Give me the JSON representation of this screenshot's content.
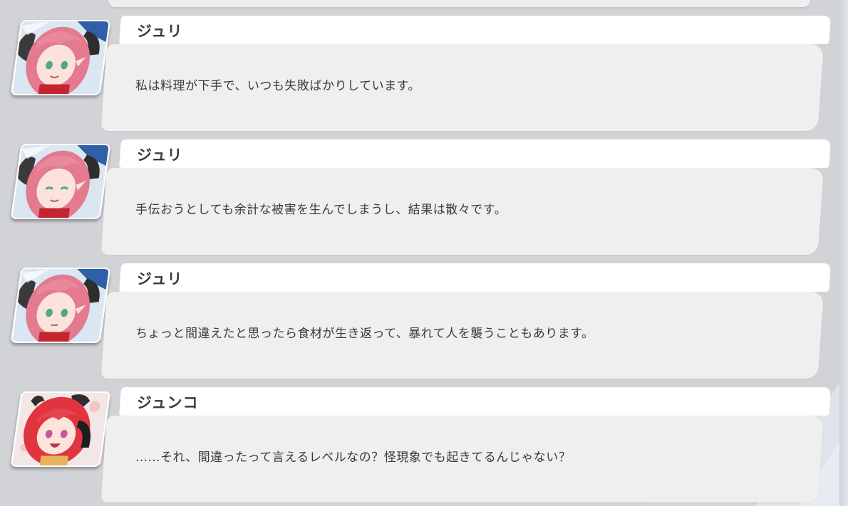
{
  "entries": [
    {
      "speaker": "ジュリ",
      "avatar": "juri-portrait",
      "text": "私は料理が下手で、いつも失敗ばかりしています。"
    },
    {
      "speaker": "ジュリ",
      "avatar": "juri-portrait",
      "text": "手伝おうとしても余計な被害を生んでしまうし、結果は散々です。"
    },
    {
      "speaker": "ジュリ",
      "avatar": "juri-portrait",
      "text": "ちょっと間違えたと思ったら食材が生き返って、暴れて人を襲うこともあります。"
    },
    {
      "speaker": "ジュンコ",
      "avatar": "junko-portrait",
      "text": "……それ、間違ったって言えるレベルなの？怪現象でも起きてるんじゃない？"
    }
  ],
  "colors": {
    "background": "#d2d3d6",
    "name_bar": "#ffffff",
    "bubble": "#efefef",
    "text": "#3a3a3a"
  }
}
